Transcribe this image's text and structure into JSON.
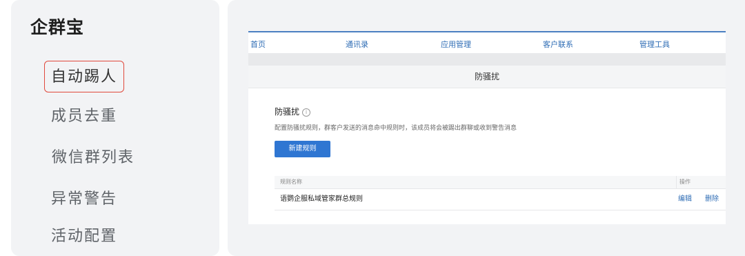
{
  "app": {
    "title": "企群宝"
  },
  "sidebar": {
    "items": [
      {
        "label": "自动踢人",
        "active": true
      },
      {
        "label": "成员去重",
        "active": false
      },
      {
        "label": "微信群列表",
        "active": false
      },
      {
        "label": "异常警告",
        "active": false
      },
      {
        "label": "活动配置",
        "active": false
      }
    ]
  },
  "topnav": {
    "items": [
      "首页",
      "通讯录",
      "应用管理",
      "客户联系",
      "管理工具"
    ]
  },
  "page": {
    "header": "防骚扰",
    "section_title": "防骚扰",
    "info_icon": "ⓘ",
    "description": "配置防骚扰规则，群客户发送的消息命中规则时，该成员将会被踢出群聊或收到警告消息",
    "new_button": "新建规则"
  },
  "table": {
    "headers": {
      "name": "规则名称",
      "actions": "操作"
    },
    "rows": [
      {
        "name": "语鹦企服私域管家群总规则",
        "edit": "编辑",
        "delete": "删除"
      }
    ]
  },
  "colors": {
    "accent_blue": "#2f76d2",
    "link_blue": "#2f6db5",
    "active_border": "#e0483b",
    "panel_bg": "#f2f3f5"
  }
}
